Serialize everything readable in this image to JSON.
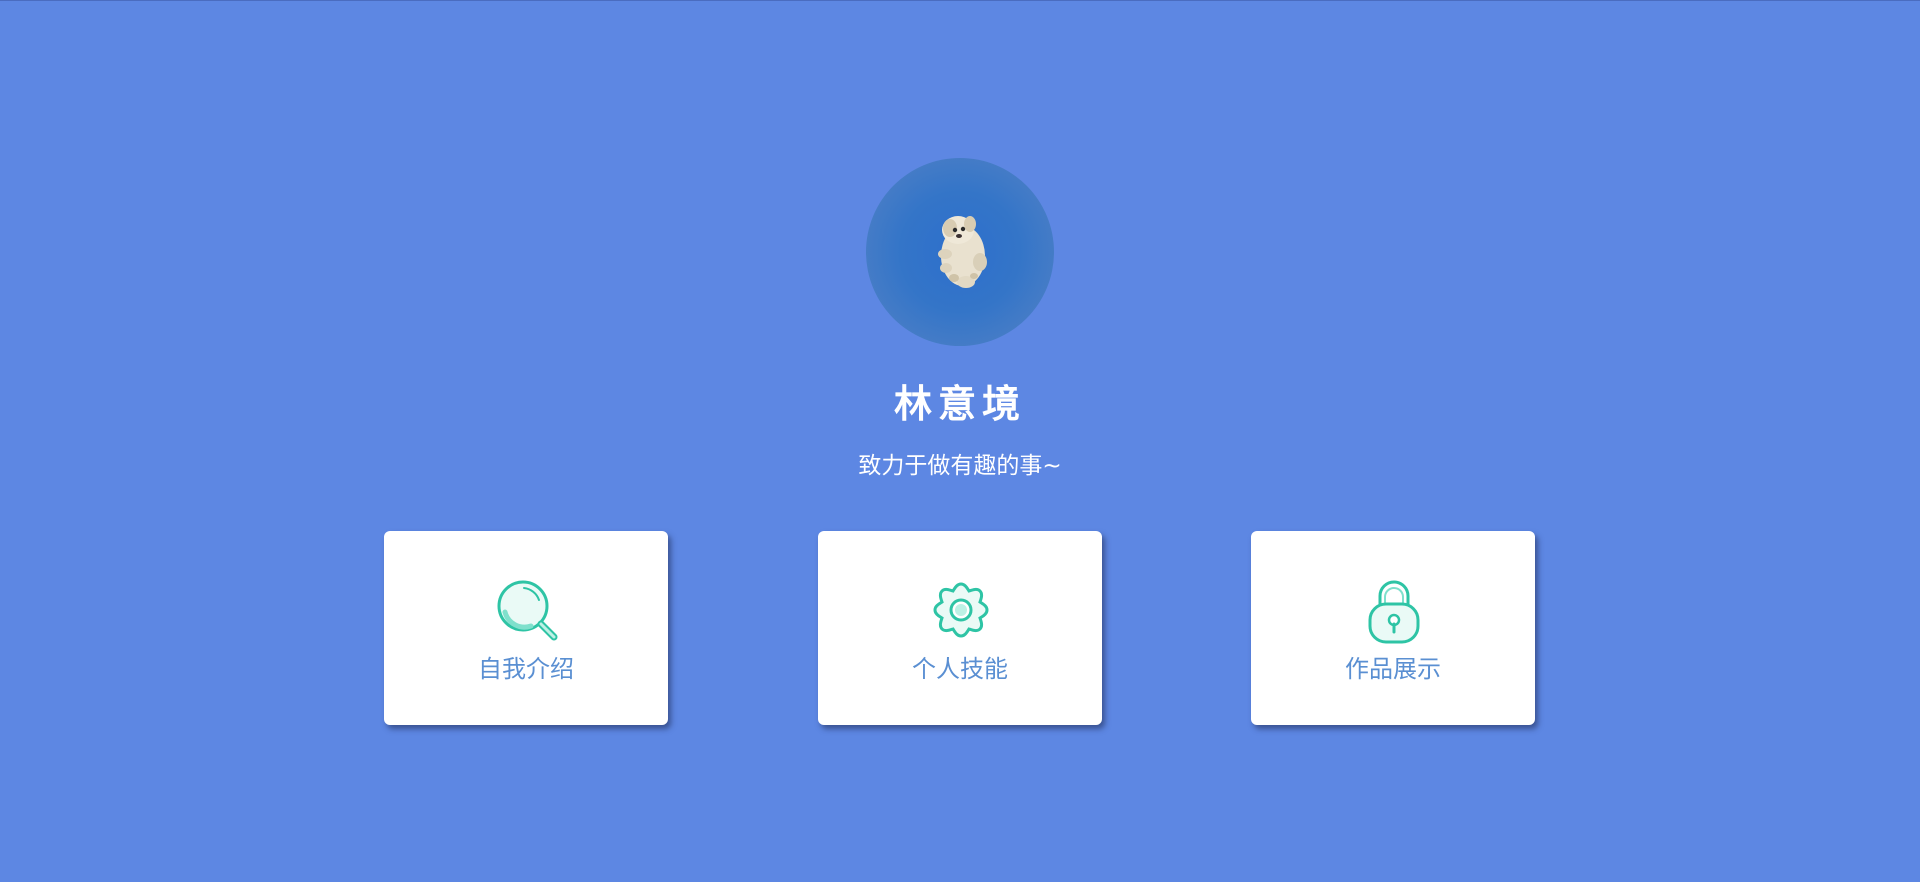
{
  "profile": {
    "name": "林意境",
    "tagline": "致力于做有趣的事~",
    "avatar_alt": ""
  },
  "cards": [
    {
      "label": "自我介绍",
      "icon": "search-icon"
    },
    {
      "label": "个人技能",
      "icon": "gear-icon"
    },
    {
      "label": "作品展示",
      "icon": "lock-icon"
    }
  ],
  "colors": {
    "background": "#5d87e3",
    "card": "#ffffff",
    "label": "#5a8fd2",
    "icon_accent": "#2ec4a5"
  }
}
